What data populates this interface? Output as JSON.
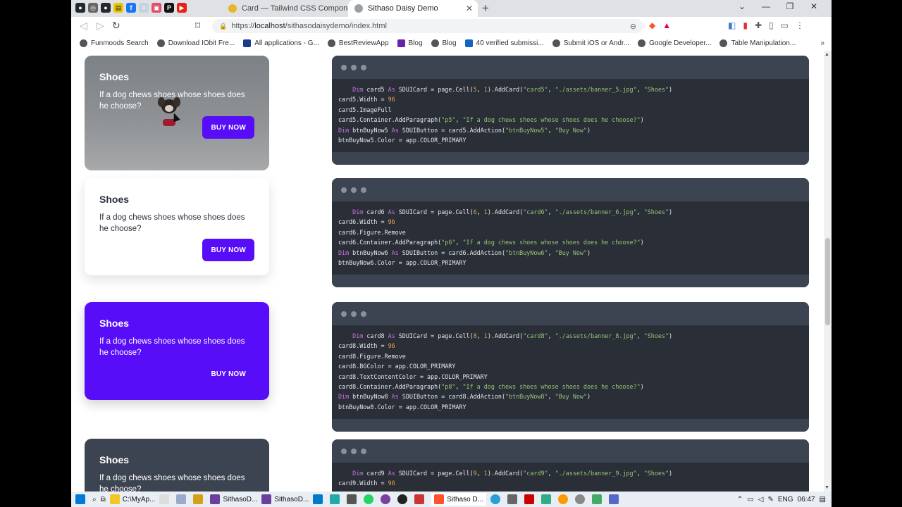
{
  "browser": {
    "tabs": [
      {
        "title": "Card — Tailwind CSS Components",
        "active": false
      },
      {
        "title": "Sithaso Daisy Demo",
        "active": true
      }
    ],
    "url_scheme": "https://",
    "url_host": "localhost",
    "url_path": "/sithasodaisydemo/index.html",
    "bookmarks": [
      "Funmoods Search",
      "Download IObit Fre...",
      "All applications - G...",
      "BestReviewApp",
      "Blog",
      "Blog",
      "40 verified submissi...",
      "Submit iOS or Andr...",
      "Google Developer...",
      "Table Manipulation..."
    ]
  },
  "cards": [
    {
      "title": "Shoes",
      "text": "If a dog chews shoes whose shoes does he choose?",
      "button": "BUY NOW"
    },
    {
      "title": "Shoes",
      "text": "If a dog chews shoes whose shoes does he choose?",
      "button": "BUY NOW"
    },
    {
      "title": "Shoes",
      "text": "If a dog chews shoes whose shoes does he choose?",
      "button": "BUY NOW"
    },
    {
      "title": "Shoes",
      "text": "If a dog chews shoes whose shoes does he choose?"
    }
  ],
  "code_blocks": [
    [
      "    Dim card5 As SDUICard = page.Cell(5, 1).AddCard(\"card5\", \"./assets/banner_5.jpg\", \"Shoes\")",
      "card5.Width = 96",
      "card5.ImageFull",
      "card5.Container.AddParagraph(\"p5\", \"If a dog chews shoes whose shoes does he choose?\")",
      "Dim btnBuyNow5 As SDUIButton = card5.AddAction(\"btnBuyNow5\", \"Buy Now\")",
      "btnBuyNow5.Color = app.COLOR_PRIMARY"
    ],
    [
      "    Dim card6 As SDUICard = page.Cell(6, 1).AddCard(\"card6\", \"./assets/banner_6.jpg\", \"Shoes\")",
      "card6.Width = 96",
      "card6.Figure.Remove",
      "card6.Container.AddParagraph(\"p6\", \"If a dog chews shoes whose shoes does he choose?\")",
      "Dim btnBuyNow6 As SDUIButton = card6.AddAction(\"btnBuyNow6\", \"Buy Now\")",
      "btnBuyNow6.Color = app.COLOR_PRIMARY"
    ],
    [
      "    Dim card8 As SDUICard = page.Cell(8, 1).AddCard(\"card8\", \"./assets/banner_8.jpg\", \"Shoes\")",
      "card8.Width = 96",
      "card8.Figure.Remove",
      "card8.BGColor = app.COLOR_PRIMARY",
      "card8.TextContentColor = app.COLOR_PRIMARY",
      "card8.Container.AddParagraph(\"p8\", \"If a dog chews shoes whose shoes does he choose?\")",
      "Dim btnBuyNow8 As SDUIButton = card8.AddAction(\"btnBuyNow8\", \"Buy Now\")",
      "btnBuyNow8.Color = app.COLOR_PRIMARY"
    ],
    [
      "    Dim card9 As SDUICard = page.Cell(9, 1).AddCard(\"card9\", \"./assets/banner_9.jpg\", \"Shoes\")",
      "card9.Width = 96"
    ]
  ],
  "taskbar": {
    "items": [
      "C:\\MyAp...",
      "SithasoD...",
      "SithasoD...",
      "Sithaso D..."
    ],
    "lang": "ENG",
    "time": "06:47"
  },
  "colors": {
    "primary": "#570df8",
    "neutral": "#3d4451",
    "code_bg": "#2a2e37"
  }
}
